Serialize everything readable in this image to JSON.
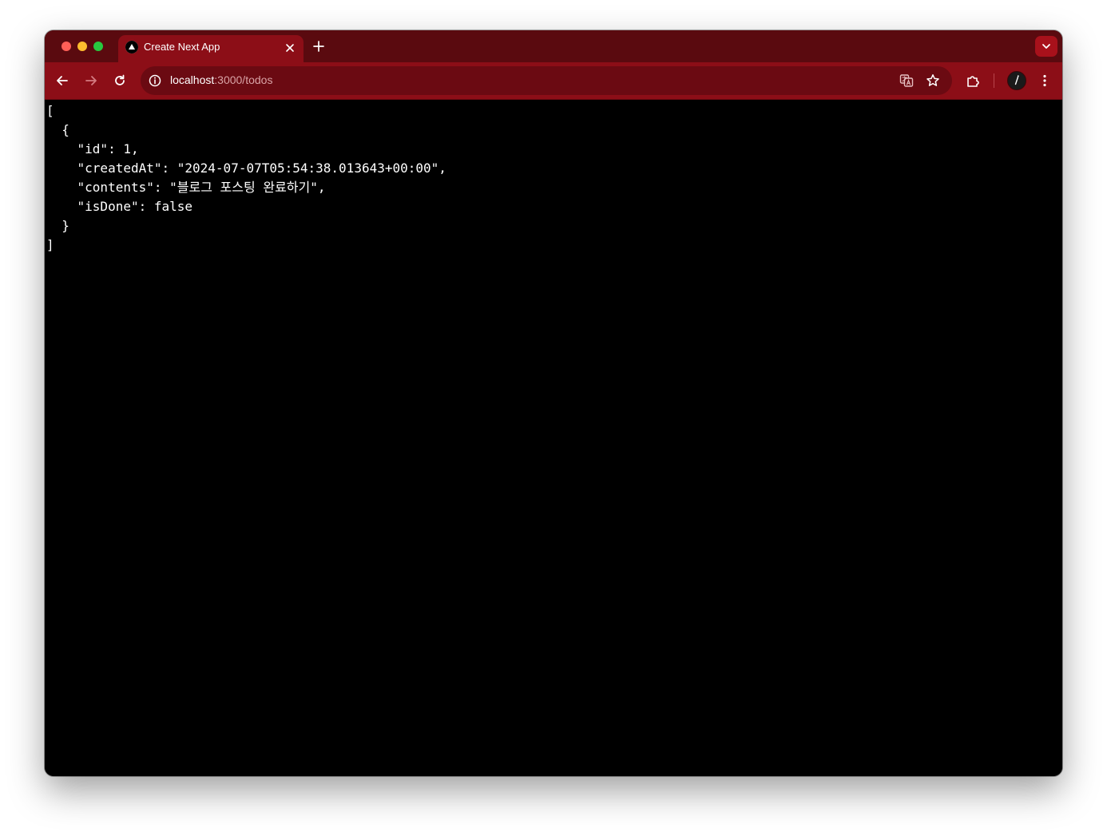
{
  "browser": {
    "tab": {
      "title": "Create Next App",
      "favicon": "nextjs-triangle-icon"
    },
    "address": {
      "host": "localhost",
      "path": ":3000/todos"
    },
    "icons": {
      "back": "arrow-left-icon",
      "forward": "arrow-right-icon",
      "reload": "reload-icon",
      "site_info": "info-icon",
      "translate": "translate-icon",
      "bookmark": "star-icon",
      "extensions": "puzzle-icon",
      "profile": "avatar",
      "menu": "kebab-menu-icon",
      "new_tab": "plus-icon",
      "tab_close": "close-icon",
      "tab_search": "chevron-down-icon"
    },
    "colors": {
      "theme_dark": "#5a0a0f",
      "theme": "#8c0e17",
      "omnibox": "#6b0a12"
    }
  },
  "json_lines": [
    "[",
    "  {",
    "    \"id\": 1,",
    "    \"createdAt\": \"2024-07-07T05:54:38.013643+00:00\",",
    "    \"contents\": \"블로그 포스팅 완료하기\",",
    "    \"isDone\": false",
    "  }",
    "]"
  ]
}
